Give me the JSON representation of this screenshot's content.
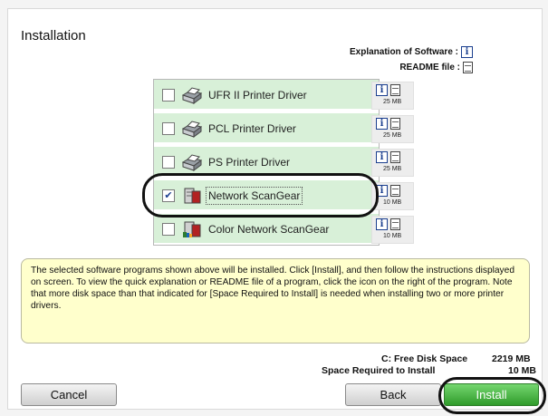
{
  "title": "Installation",
  "legend": {
    "explanation_label": "Explanation of Software :",
    "readme_label": "README file :"
  },
  "software": [
    {
      "name": "UFR II Printer Driver",
      "size": "25 MB",
      "checked": false,
      "icon": "printer-icon"
    },
    {
      "name": "PCL Printer Driver",
      "size": "25 MB",
      "checked": false,
      "icon": "printer-icon"
    },
    {
      "name": "PS Printer Driver",
      "size": "25 MB",
      "checked": false,
      "icon": "printer-icon"
    },
    {
      "name": "Network ScanGear",
      "size": "10 MB",
      "checked": true,
      "icon": "scangear-icon"
    },
    {
      "name": "Color Network ScanGear",
      "size": "10 MB",
      "checked": false,
      "icon": "color-scangear-icon"
    }
  ],
  "description": "The selected software programs shown above will be installed. Click [Install], and then follow the instructions displayed on screen. To view the quick explanation or README file of a program, click the icon on the right of the program. Note that more disk space than that indicated for [Space Required to Install] is needed when installing two or more printer drivers.",
  "disk": {
    "free_label": "C: Free Disk Space",
    "free_value": "2219 MB",
    "required_label": "Space Required to Install",
    "required_value": "10 MB"
  },
  "buttons": {
    "cancel": "Cancel",
    "back": "Back",
    "install": "Install"
  },
  "colors": {
    "row_bg": "#d8f0d8",
    "info_bg": "#ffffcc",
    "install_button": "#3fae3a"
  }
}
